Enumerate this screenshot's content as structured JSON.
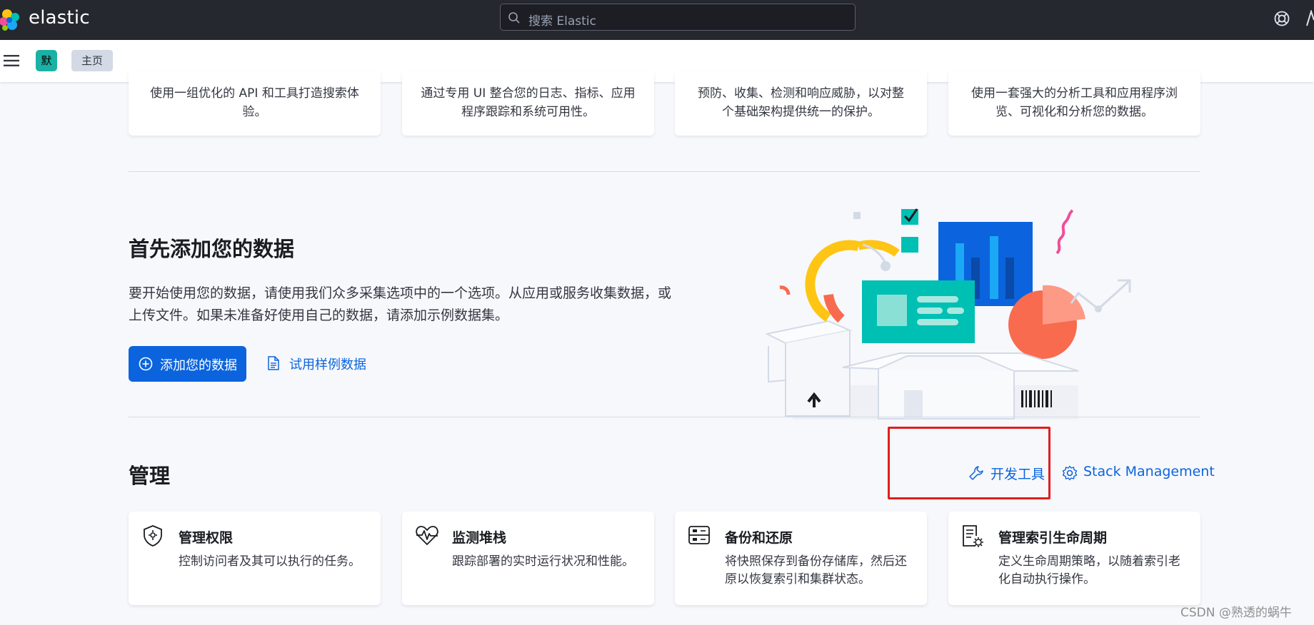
{
  "topbar": {
    "brand": "elastic",
    "search_placeholder": "搜索 Elastic",
    "icons": [
      "elastic-logo",
      "search-icon",
      "help-icon",
      "user-icon"
    ]
  },
  "subbar": {
    "icons": [
      "menu-icon"
    ],
    "space_badge": "默",
    "breadcrumb": "主页"
  },
  "solutions_cards": [
    {
      "desc": "使用一组优化的 API 和工具打造搜索体验。"
    },
    {
      "desc": "通过专用 UI 整合您的日志、指标、应用程序跟踪和系统可用性。"
    },
    {
      "desc": "预防、收集、检测和响应威胁，以对整个基础架构提供统一的保护。"
    },
    {
      "desc": "使用一套强大的分析工具和应用程序浏览、可视化和分析您的数据。"
    }
  ],
  "add_data": {
    "title": "首先添加您的数据",
    "description": "要开始使用您的数据，请使用我们众多采集选项中的一个选项。从应用或服务收集数据，或上传文件。如果未准备好使用自己的数据，请添加示例数据集。",
    "primary_button": "添加您的数据",
    "sample_link": "试用样例数据",
    "icons": [
      "plus-circle-icon",
      "document-icon",
      "add-data-illustration"
    ]
  },
  "manage": {
    "title": "管理",
    "dev_tools_link": "开发工具",
    "stack_management_link": "Stack Management",
    "icons": [
      "wrench-icon",
      "gear-icon"
    ],
    "cards": [
      {
        "title": "管理权限",
        "desc": "控制访问者及其可以执行的任务。",
        "icon": "shield-icon"
      },
      {
        "title": "监测堆栈",
        "desc": "跟踪部署的实时运行状况和性能。",
        "icon": "heartbeat-icon"
      },
      {
        "title": "备份和还原",
        "desc": "将快照保存到备份存储库，然后还原以恢复索引和集群状态。",
        "icon": "storage-icon"
      },
      {
        "title": "管理索引生命周期",
        "desc": "定义生命周期策略，以随着索引老化自动执行操作。",
        "icon": "lifecycle-icon"
      }
    ]
  },
  "colors": {
    "topbar_bg": "#25282f",
    "primary": "#0b64dd",
    "page_bg": "#f7f8fc",
    "highlight": "#e01e1e",
    "space_badge": "#1bb1a4"
  },
  "watermark": "CSDN @熟透的蜗牛"
}
